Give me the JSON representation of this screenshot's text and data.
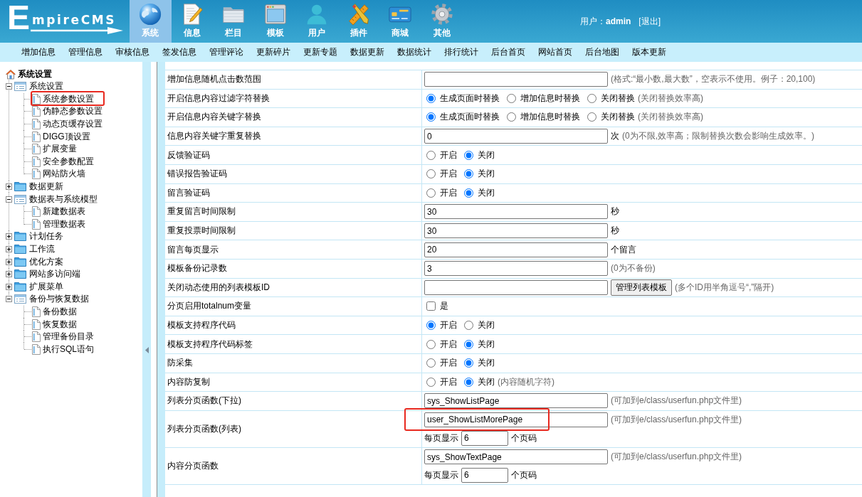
{
  "header": {
    "logo": "EmpireCMS",
    "nav": [
      {
        "label": "系统",
        "selected": true
      },
      {
        "label": "信息",
        "selected": false
      },
      {
        "label": "栏目",
        "selected": false
      },
      {
        "label": "模板",
        "selected": false
      },
      {
        "label": "用户",
        "selected": false
      },
      {
        "label": "插件",
        "selected": false
      },
      {
        "label": "商城",
        "selected": false
      },
      {
        "label": "其他",
        "selected": false
      }
    ],
    "user": {
      "label": "用户：",
      "name": "admin",
      "logout": "[退出]"
    }
  },
  "subnav": [
    "增加信息",
    "管理信息",
    "审核信息",
    "签发信息",
    "管理评论",
    "更新碎片",
    "更新专题",
    "数据更新",
    "数据统计",
    "排行统计",
    "后台首页",
    "网站首页",
    "后台地图",
    "版本更新"
  ],
  "sidebar": {
    "root": "系统设置",
    "tree": [
      {
        "label": "系统设置",
        "expanded": true,
        "highlighted": false,
        "children": [
          {
            "label": "系统参数设置",
            "highlighted": true
          },
          {
            "label": "伪静态参数设置",
            "highlighted": false
          },
          {
            "label": "动态页缓存设置",
            "highlighted": false
          },
          {
            "label": "DIGG顶设置",
            "highlighted": false
          },
          {
            "label": "扩展变量",
            "highlighted": false
          },
          {
            "label": "安全参数配置",
            "highlighted": false
          },
          {
            "label": "网站防火墙",
            "highlighted": false
          }
        ]
      },
      {
        "label": "数据更新",
        "expanded": false,
        "highlighted": false
      },
      {
        "label": "数据表与系统模型",
        "expanded": true,
        "highlighted": false,
        "children": [
          {
            "label": "新建数据表",
            "highlighted": false
          },
          {
            "label": "管理数据表",
            "highlighted": false
          }
        ]
      },
      {
        "label": "计划任务",
        "expanded": false,
        "highlighted": false
      },
      {
        "label": "工作流",
        "expanded": false,
        "highlighted": false
      },
      {
        "label": "优化方案",
        "expanded": false,
        "highlighted": false
      },
      {
        "label": "网站多访问端",
        "expanded": false,
        "highlighted": false
      },
      {
        "label": "扩展菜单",
        "expanded": false,
        "highlighted": false
      },
      {
        "label": "备份与恢复数据",
        "expanded": true,
        "highlighted": false,
        "children": [
          {
            "label": "备份数据",
            "highlighted": false
          },
          {
            "label": "恢复数据",
            "highlighted": false
          },
          {
            "label": "管理备份目录",
            "highlighted": false
          },
          {
            "label": "执行SQL语句",
            "highlighted": false
          }
        ]
      }
    ]
  },
  "settings": {
    "rows": [
      {
        "kind": "input",
        "label": "增加信息随机点击数范围",
        "hint": "(格式:“最小数,最大数”，空表示不使用。例子：20,100)",
        "highlighted": false
      },
      {
        "kind": "radio",
        "label": "开启信息内容过滤字符替换",
        "options": [
          {
            "label": "生成页面时替换",
            "selected": true
          },
          {
            "label": "增加信息时替换",
            "selected": false
          },
          {
            "label": "关闭替换",
            "selected": false
          }
        ],
        "hint": "(关闭替换效率高)",
        "highlighted": false
      },
      {
        "kind": "radio",
        "label": "开启信息内容关键字替换",
        "options": [
          {
            "label": "生成页面时替换",
            "selected": true
          },
          {
            "label": "增加信息时替换",
            "selected": false
          },
          {
            "label": "关闭替换",
            "selected": false
          }
        ],
        "hint": "(关闭替换效率高)",
        "highlighted": false
      },
      {
        "kind": "input",
        "label": "信息内容关键字重复替换",
        "value": "0",
        "unit": "次",
        "hint": "(0为不限,效率高；限制替换次数会影响生成效率。)",
        "highlighted": false
      },
      {
        "kind": "radio",
        "label": "反馈验证码",
        "options": [
          {
            "label": "开启",
            "selected": false
          },
          {
            "label": "关闭",
            "selected": true
          }
        ],
        "highlighted": false
      },
      {
        "kind": "radio",
        "label": "错误报告验证码",
        "options": [
          {
            "label": "开启",
            "selected": false
          },
          {
            "label": "关闭",
            "selected": true
          }
        ],
        "highlighted": false
      },
      {
        "kind": "radio",
        "label": "留言验证码",
        "options": [
          {
            "label": "开启",
            "selected": false
          },
          {
            "label": "关闭",
            "selected": true
          }
        ],
        "highlighted": false
      },
      {
        "kind": "input",
        "label": "重复留言时间限制",
        "value": "30",
        "unit": "秒",
        "highlighted": false
      },
      {
        "kind": "input",
        "label": "重复投票时间限制",
        "value": "30",
        "unit": "秒",
        "highlighted": false
      },
      {
        "kind": "input",
        "label": "留言每页显示",
        "value": "20",
        "unit": "个留言",
        "highlighted": false
      },
      {
        "kind": "input",
        "label": "模板备份记录数",
        "value": "3",
        "hint": "(0为不备份)",
        "highlighted": false
      },
      {
        "kind": "input",
        "label": "关闭动态使用的列表模板ID",
        "button": "管理列表模板",
        "hint": "(多个ID用半角逗号“,”隔开)",
        "highlighted": false
      },
      {
        "kind": "checkbox",
        "label": "分页启用totalnum变量",
        "option": "是",
        "checked": false,
        "highlighted": false
      },
      {
        "kind": "radio",
        "label": "模板支持程序代码",
        "options": [
          {
            "label": "开启",
            "selected": true
          },
          {
            "label": "关闭",
            "selected": false
          }
        ],
        "highlighted": false
      },
      {
        "kind": "radio",
        "label": "模板支持程序代码标签",
        "options": [
          {
            "label": "开启",
            "selected": false
          },
          {
            "label": "关闭",
            "selected": true
          }
        ],
        "highlighted": false
      },
      {
        "kind": "radio",
        "label": "防采集",
        "options": [
          {
            "label": "开启",
            "selected": false
          },
          {
            "label": "关闭",
            "selected": true
          }
        ],
        "highlighted": false
      },
      {
        "kind": "radio",
        "label": "内容防复制",
        "options": [
          {
            "label": "开启",
            "selected": false
          },
          {
            "label": "关闭",
            "selected": true
          }
        ],
        "hint": "(内容随机字符)",
        "highlighted": false
      },
      {
        "kind": "input",
        "label": "列表分页函数(下拉)",
        "value": "sys_ShowListPage",
        "hint": "(可加到e/class/userfun.php文件里)",
        "highlighted": false
      },
      {
        "kind": "paged",
        "label": "列表分页函数(列表)",
        "value": "user_ShowListMorePage",
        "hint": "(可加到e/class/userfun.php文件里)",
        "per_page": {
          "label": "每页显示",
          "value": "6",
          "unit": "个页码"
        },
        "highlighted": true
      },
      {
        "kind": "paged",
        "label": "内容分页函数",
        "value": "sys_ShowTextPage",
        "hint": "(可加到e/class/userfun.php文件里)",
        "per_page": {
          "label": "每页显示",
          "value": "6",
          "unit": "个页码"
        },
        "highlighted": false
      }
    ]
  }
}
